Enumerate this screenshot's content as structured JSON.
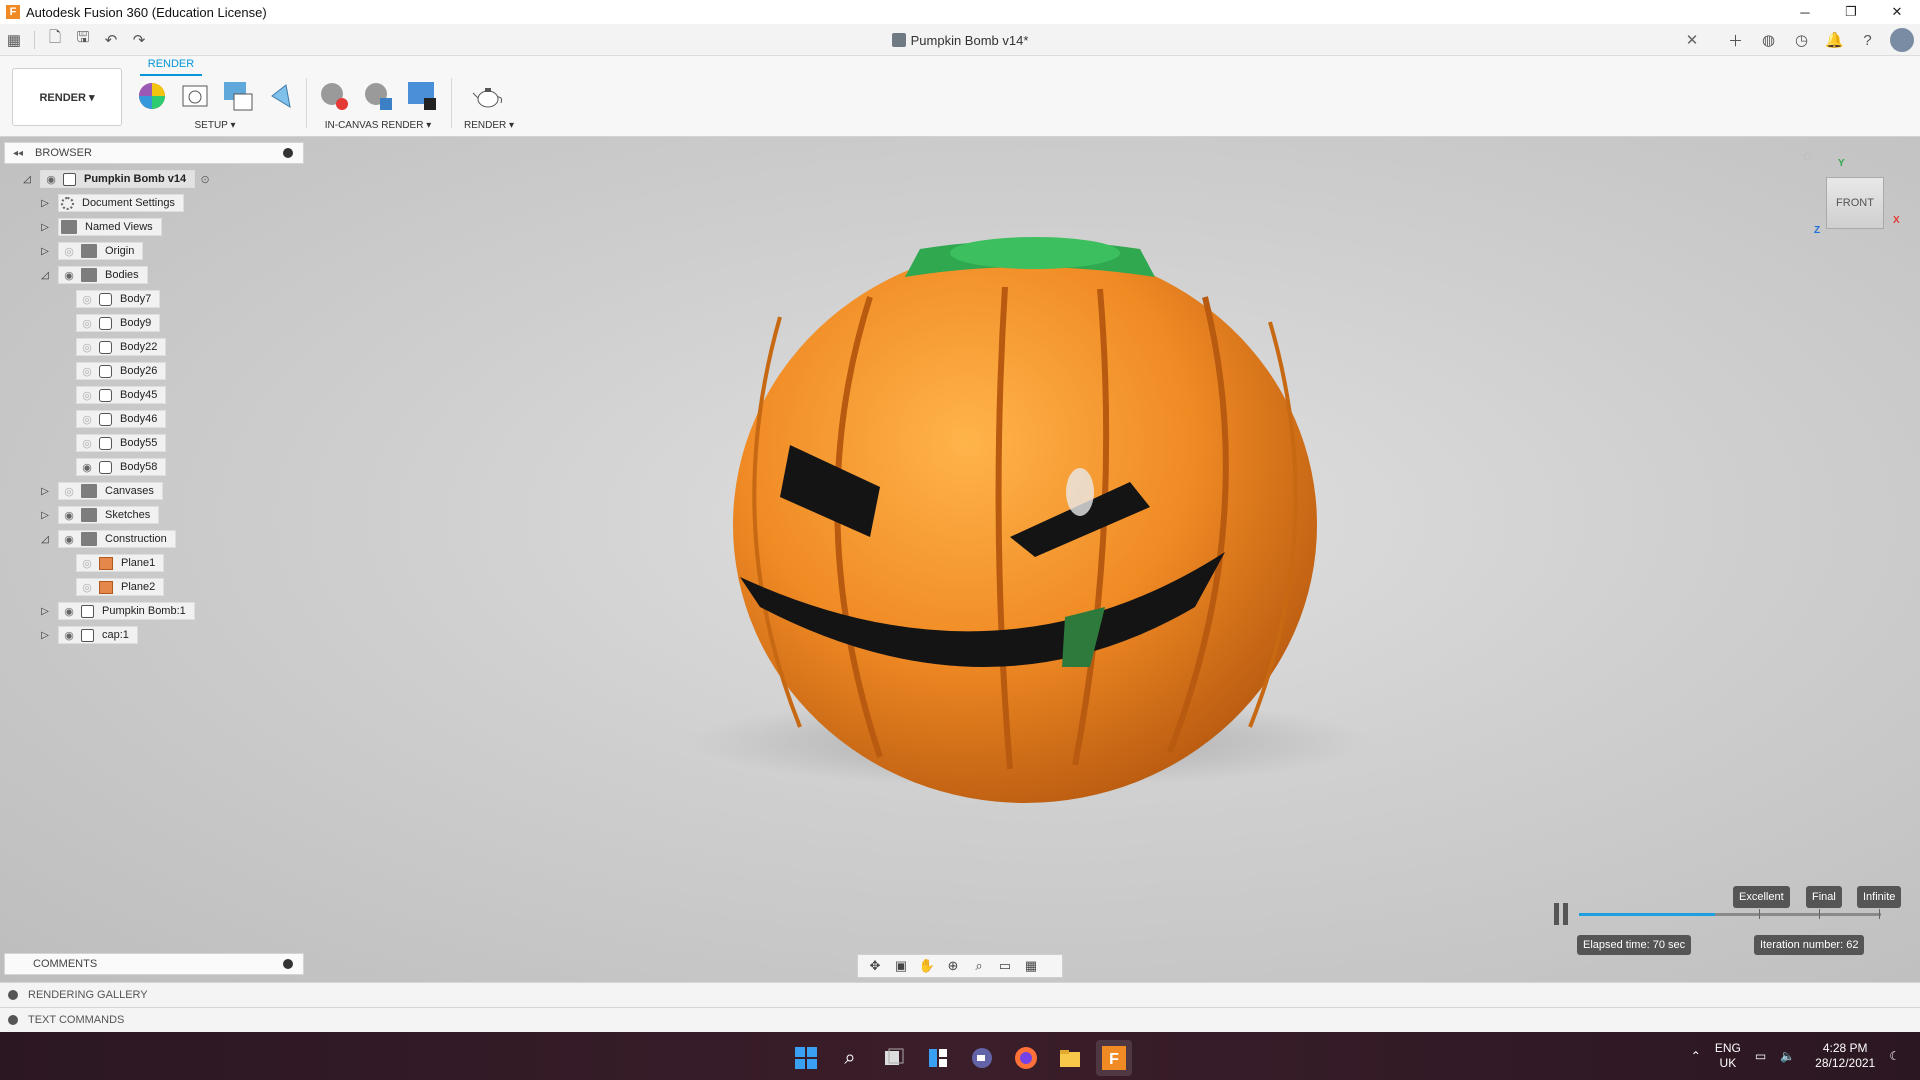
{
  "window": {
    "title": "Autodesk Fusion 360 (Education License)",
    "minimize": "─",
    "maximize": "❐",
    "close": "✕"
  },
  "document": {
    "tab_title": "Pumpkin Bomb v14*",
    "close": "✕"
  },
  "ribbon": {
    "tab_label": "RENDER",
    "workspace_label": "RENDER ▾",
    "groups": {
      "setup": "SETUP ▾",
      "in_canvas_render": "IN-CANVAS RENDER ▾",
      "render": "RENDER ▾"
    }
  },
  "browser": {
    "header": "BROWSER",
    "collapse": "◂◂",
    "tree": {
      "root": "Pumpkin Bomb v14",
      "document_settings": "Document Settings",
      "named_views": "Named Views",
      "origin": "Origin",
      "bodies": "Bodies",
      "body_items": [
        "Body7",
        "Body9",
        "Body22",
        "Body26",
        "Body45",
        "Body46",
        "Body55",
        "Body58"
      ],
      "canvases": "Canvases",
      "sketches": "Sketches",
      "construction": "Construction",
      "plane1": "Plane1",
      "plane2": "Plane2",
      "component1": "Pumpkin Bomb:1",
      "component2": "cap:1"
    }
  },
  "comments": {
    "header": "COMMENTS"
  },
  "bottom_panels": {
    "rendering_gallery": "RENDERING GALLERY",
    "text_commands": "TEXT COMMANDS"
  },
  "viewcube": {
    "face": "FRONT",
    "axis_y": "Y",
    "axis_x": "X",
    "axis_z": "Z"
  },
  "render_controls": {
    "quality_levels": [
      "Excellent",
      "Final",
      "Infinite"
    ],
    "progress_fraction": 0.45,
    "elapsed": "Elapsed time: 70 sec",
    "iteration": "Iteration number: 62"
  },
  "taskbar": {
    "language": "ENG",
    "region": "UK",
    "time": "4:28 PM",
    "date": "28/12/2021"
  },
  "colors": {
    "accent": "#0696d7",
    "pumpkin": "#f08a24",
    "stem": "#2fa84f"
  }
}
